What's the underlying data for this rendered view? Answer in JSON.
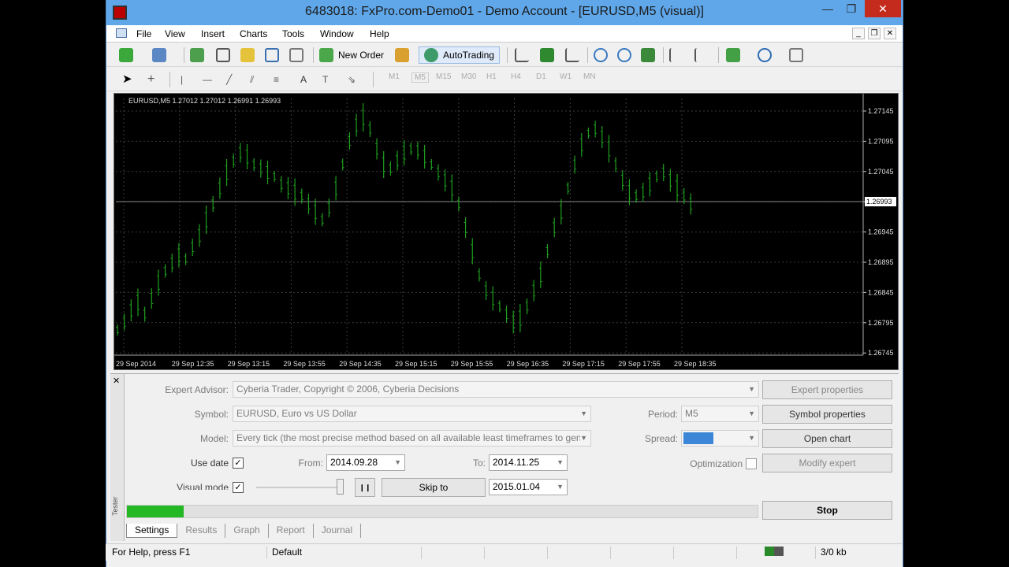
{
  "window": {
    "title": "6483018: FxPro.com-Demo01 - Demo Account - [EURUSD,M5 (visual)]",
    "controls": [
      "—",
      "❐",
      "✕"
    ]
  },
  "menu": [
    "File",
    "View",
    "Insert",
    "Charts",
    "Tools",
    "Window",
    "Help"
  ],
  "toolbar": {
    "new_order": "New Order",
    "autotrading": "AutoTrading",
    "periods": [
      "M1",
      "M5",
      "M15",
      "M30",
      "H1",
      "H4",
      "D1",
      "W1",
      "MN"
    ],
    "text_tool": "A"
  },
  "chart": {
    "header": "EURUSD,M5  1.27012 1.27012 1.26991 1.26993",
    "current_price": "1.26993",
    "price_levels": [
      "1.27145",
      "1.27095",
      "1.27045",
      "1.26995",
      "1.26945",
      "1.26895",
      "1.26845",
      "1.26795",
      "1.26745"
    ],
    "time_labels": [
      "29 Sep 2014",
      "29 Sep 12:35",
      "29 Sep 13:15",
      "29 Sep 13:55",
      "29 Sep 14:35",
      "29 Sep 15:15",
      "29 Sep 15:55",
      "29 Sep 16:35",
      "29 Sep 17:15",
      "29 Sep 17:55",
      "29 Sep 18:35"
    ],
    "colors": {
      "bg": "#000000",
      "bars": "#1f9f1f",
      "grid": "#3a3a3a"
    }
  },
  "tester": {
    "side_label": "Tester",
    "expert_advisor_label": "Expert Advisor:",
    "expert_advisor_value": "Cyberia Trader, Copyright © 2006, Cyberia Decisions",
    "symbol_label": "Symbol:",
    "symbol_value": "EURUSD, Euro vs US Dollar",
    "model_label": "Model:",
    "model_value": "Every tick (the most precise method based on all available least timeframes to gene",
    "use_date_label": "Use date",
    "from_label": "From:",
    "from_value": "2014.09.28",
    "to_label": "To:",
    "to_value": "2014.11.25",
    "visual_mode_label": "Visual mode",
    "skip_to": "Skip to",
    "skip_date": "2015.01.04",
    "period_label": "Period:",
    "period_value": "M5",
    "spread_label": "Spread:",
    "optimization_label": "Optimization",
    "expert_properties": "Expert properties",
    "symbol_properties": "Symbol properties",
    "open_chart": "Open chart",
    "modify_expert": "Modify expert",
    "stop": "Stop",
    "pause": "❙❙",
    "progress_fraction": 0.09,
    "tabs": [
      "Settings",
      "Results",
      "Graph",
      "Report",
      "Journal"
    ]
  },
  "status": {
    "help": "For Help, press F1",
    "profile": "Default",
    "traffic": "3/0 kb"
  }
}
